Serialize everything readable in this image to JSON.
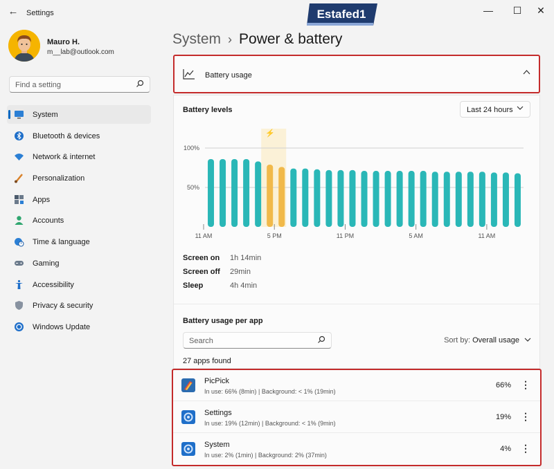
{
  "window": {
    "title": "Settings",
    "back_glyph": "←",
    "minimize_glyph": "—",
    "maximize_glyph": "☐",
    "close_glyph": "✕",
    "watermark_text": "Estafed1"
  },
  "user": {
    "name": "Mauro H.",
    "email": "m__lab@outlook.com"
  },
  "search": {
    "placeholder": "Find a setting"
  },
  "sidebar": {
    "items": [
      {
        "label": "System",
        "icon": "monitor-icon",
        "active": true
      },
      {
        "label": "Bluetooth & devices",
        "icon": "bluetooth-icon"
      },
      {
        "label": "Network & internet",
        "icon": "wifi-icon"
      },
      {
        "label": "Personalization",
        "icon": "brush-icon"
      },
      {
        "label": "Apps",
        "icon": "apps-icon"
      },
      {
        "label": "Accounts",
        "icon": "person-icon"
      },
      {
        "label": "Time & language",
        "icon": "globe-clock-icon"
      },
      {
        "label": "Gaming",
        "icon": "gamepad-icon"
      },
      {
        "label": "Accessibility",
        "icon": "accessibility-icon"
      },
      {
        "label": "Privacy & security",
        "icon": "shield-icon"
      },
      {
        "label": "Windows Update",
        "icon": "update-icon"
      }
    ]
  },
  "breadcrumb": {
    "parent": "System",
    "separator": "›",
    "current": "Power & battery"
  },
  "battery_usage": {
    "label": "Battery usage",
    "expanded": true
  },
  "battery_levels": {
    "title": "Battery levels",
    "range_selected": "Last 24 hours"
  },
  "chart_data": {
    "type": "bar",
    "y_ticks": [
      "100%",
      "50%"
    ],
    "x_ticks": [
      "11 AM",
      "5 PM",
      "11 PM",
      "5 AM",
      "11 AM"
    ],
    "values": [
      86,
      86,
      86,
      86,
      83,
      79,
      76,
      74,
      74,
      73,
      72,
      72,
      72,
      71,
      71,
      71,
      71,
      71,
      71,
      70,
      70,
      70,
      70,
      70,
      69,
      69,
      68
    ],
    "charging_bars": [
      5,
      6
    ],
    "ylim": [
      0,
      100
    ],
    "colors": {
      "normal": "#2ab7b7",
      "charging": "#f1b94a",
      "charging_bg": "#fbf1d7"
    }
  },
  "stats": [
    {
      "label": "Screen on",
      "value": "1h 14min"
    },
    {
      "label": "Screen off",
      "value": "29min"
    },
    {
      "label": "Sleep",
      "value": "4h 4min"
    }
  ],
  "per_app": {
    "title": "Battery usage per app",
    "search_placeholder": "Search",
    "sort_label": "Sort by:",
    "sort_value": "Overall usage",
    "apps_found": "27 apps found",
    "apps": [
      {
        "name": "PicPick",
        "detail": "In use: 66% (8min) | Background: < 1% (19min)",
        "percent": "66%",
        "icon": "picpick-icon"
      },
      {
        "name": "Settings",
        "detail": "In use: 19% (12min) | Background: < 1% (9min)",
        "percent": "19%",
        "icon": "settings-app-icon"
      },
      {
        "name": "System",
        "detail": "In use: 2% (1min) | Background: 2% (37min)",
        "percent": "4%",
        "icon": "system-app-icon"
      }
    ]
  }
}
